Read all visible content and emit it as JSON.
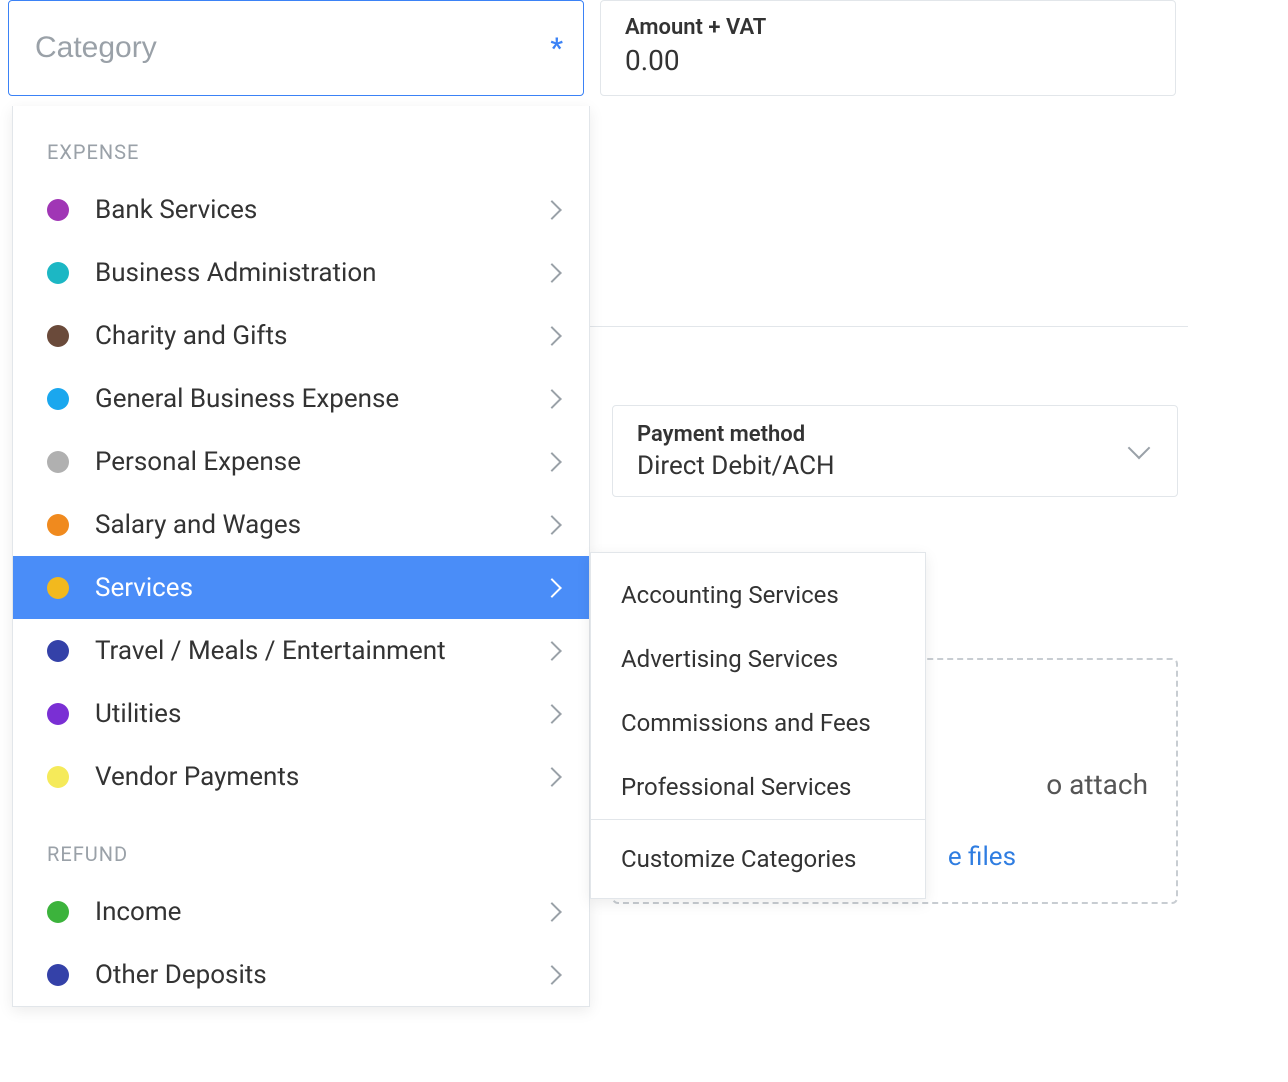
{
  "category_input": {
    "placeholder": "Category",
    "required_marker": "*"
  },
  "amount_field": {
    "label": "Amount + VAT",
    "value": "0.00"
  },
  "payment_method": {
    "label": "Payment method",
    "value": "Direct Debit/ACH"
  },
  "attach": {
    "hint_fragment": "o attach",
    "link_fragment": "e files"
  },
  "dropdown": {
    "groups": [
      {
        "label": "EXPENSE",
        "items": [
          {
            "label": "Bank Services",
            "color": "#a036b5"
          },
          {
            "label": "Business Administration",
            "color": "#1cb7c4"
          },
          {
            "label": "Charity and Gifts",
            "color": "#6a4a3a"
          },
          {
            "label": "General Business Expense",
            "color": "#1aa7ee"
          },
          {
            "label": "Personal Expense",
            "color": "#b0b0b0"
          },
          {
            "label": "Salary and Wages",
            "color": "#f08a1e"
          },
          {
            "label": "Services",
            "color": "#f2b91e",
            "highlight": true
          },
          {
            "label": "Travel / Meals / Entertainment",
            "color": "#3441a8"
          },
          {
            "label": "Utilities",
            "color": "#7a2fd4"
          },
          {
            "label": "Vendor Payments",
            "color": "#f5ea5a"
          }
        ]
      },
      {
        "label": "REFUND",
        "items": [
          {
            "label": "Income",
            "color": "#3cb33c"
          },
          {
            "label": "Other Deposits",
            "color": "#3441a8"
          }
        ]
      }
    ]
  },
  "submenu": {
    "items": [
      "Accounting Services",
      "Advertising Services",
      "Commissions and Fees",
      "Professional Services"
    ],
    "footer": "Customize Categories"
  }
}
